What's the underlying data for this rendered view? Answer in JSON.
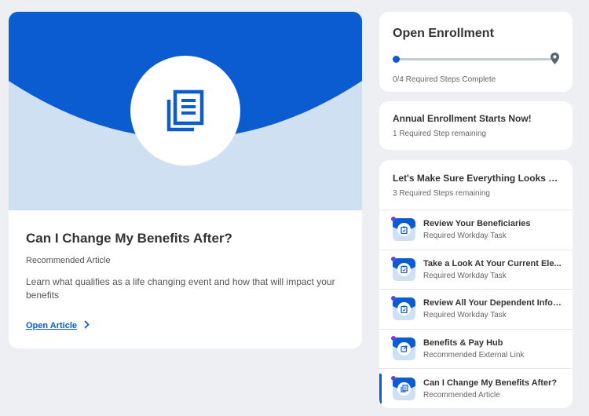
{
  "article": {
    "title": "Can I Change My Benefits After?",
    "type": "Recommended Article",
    "description": "Learn what qualifies as a life changing event and how that will impact your benefits",
    "link_label": "Open Article",
    "hero_icon": "documents-icon"
  },
  "enrollment": {
    "title": "Open Enrollment",
    "progress_fraction": 0,
    "status": "0/4 Required Steps Complete"
  },
  "annual": {
    "title": "Annual Enrollment Starts Now!",
    "subtitle": "1 Required Step remaining"
  },
  "tasks": {
    "title": "Let's Make Sure Everything Looks G...",
    "subtitle": "3 Required Steps remaining",
    "items": [
      {
        "title": "Review Your Beneficiaries",
        "subtitle": "Required Workday Task",
        "icon": "clipboard-icon"
      },
      {
        "title": "Take a Look At Your Current Ele...",
        "subtitle": "Required Workday Task",
        "icon": "clipboard-icon"
      },
      {
        "title": "Review All Your Dependent Infor...",
        "subtitle": "Required Workday Task",
        "icon": "clipboard-icon"
      },
      {
        "title": "Benefits & Pay Hub",
        "subtitle": "Recommended External Link",
        "icon": "external-link-icon"
      },
      {
        "title": "Can I Change My Benefits After?",
        "subtitle": "Recommended Article",
        "icon": "documents-icon"
      }
    ]
  },
  "colors": {
    "accent": "#0b5cd0",
    "hero_light": "#cfe0f2",
    "new_dot": "#6f3fdc",
    "background": "#edeff2"
  }
}
